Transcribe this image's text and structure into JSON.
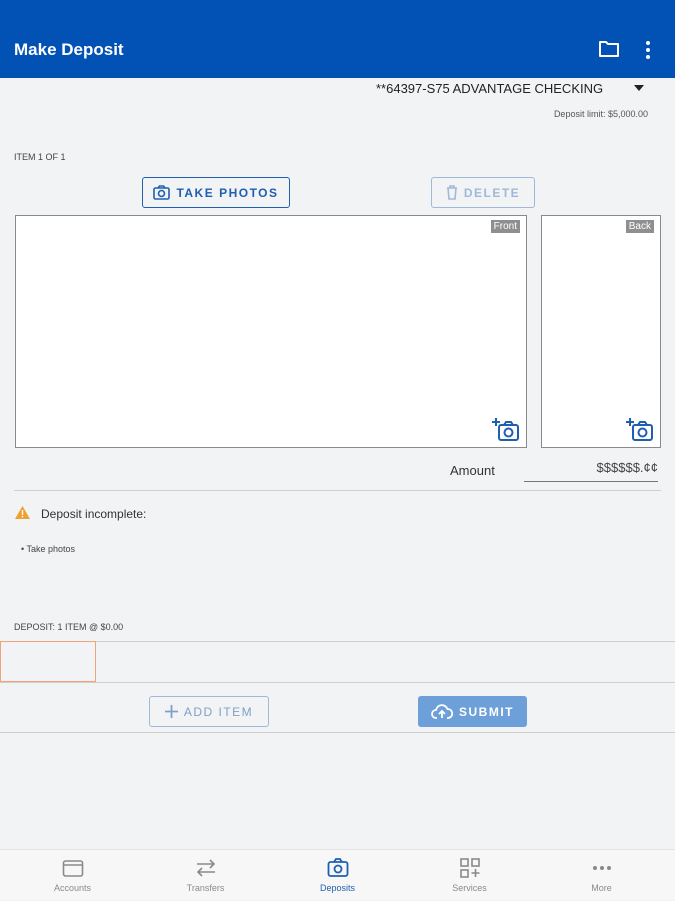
{
  "header": {
    "title": "Make Deposit",
    "icons": [
      "folder-icon",
      "more-vert-icon"
    ]
  },
  "account": {
    "name": "**64397-S75 ADVANTAGE CHECKING",
    "limit": "Deposit limit: $5,000.00"
  },
  "item": {
    "label": "ITEM 1 OF 1",
    "take_photos": "TAKE PHOTOS",
    "delete": "DELETE",
    "front_tag": "Front",
    "back_tag": "Back",
    "amount_label": "Amount",
    "amount_value": "$$$$$$.¢¢"
  },
  "status": {
    "warning": "Deposit incomplete:",
    "todo": "• Take photos"
  },
  "summary": "DEPOSIT: 1 ITEM @ $0.00",
  "actions": {
    "add_item": "ADD ITEM",
    "submit": "SUBMIT"
  },
  "nav": {
    "active": "Deposits",
    "tabs": [
      {
        "label": "Accounts",
        "icon": "wallet-icon"
      },
      {
        "label": "Transfers",
        "icon": "transfer-icon"
      },
      {
        "label": "Deposits",
        "icon": "camera-icon"
      },
      {
        "label": "Services",
        "icon": "services-grid-icon"
      },
      {
        "label": "More",
        "icon": "more-horiz-icon"
      }
    ]
  },
  "colors": {
    "brand": "#0152b4",
    "accent": "#1f5fb0",
    "warning": "#f0a030",
    "submit_bg": "#6da0d8"
  }
}
